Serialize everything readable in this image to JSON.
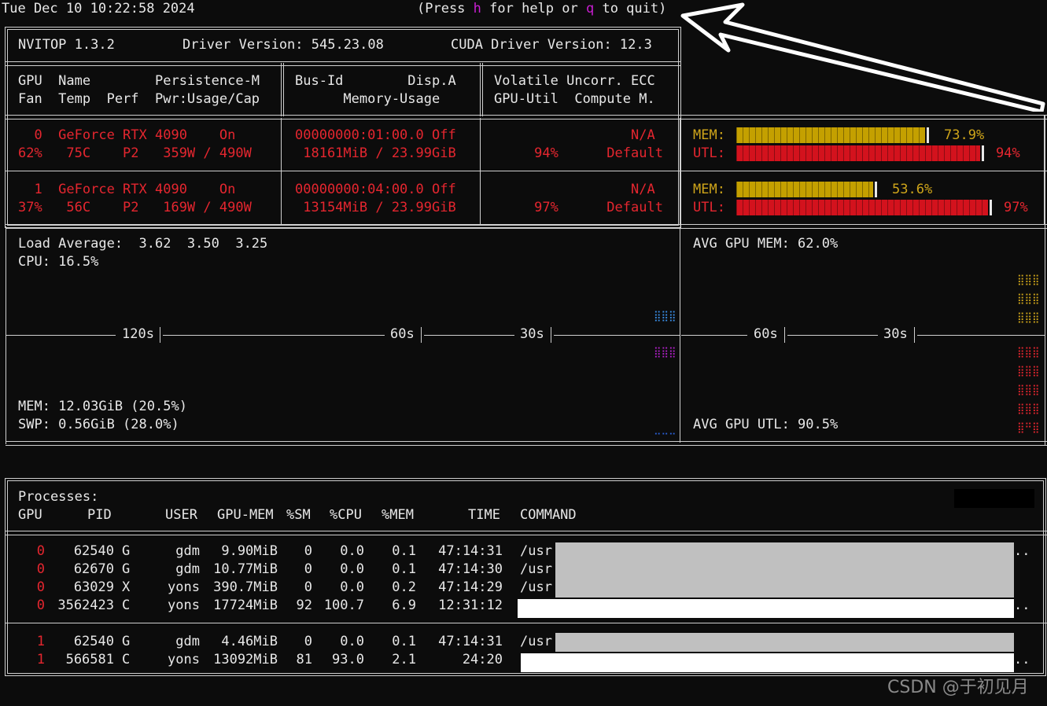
{
  "topbar": {
    "datetime": "Tue Dec 10 10:22:58 2024",
    "help_prefix": "(Press ",
    "help_key": "h",
    "help_mid": " for help or ",
    "quit_key": "q",
    "help_suffix": " to quit)"
  },
  "header": {
    "app": "NVITOP 1.3.2",
    "driver": "Driver Version: 545.23.08",
    "cuda": "CUDA Driver Version: 12.3"
  },
  "columns": {
    "c1_r1": "GPU  Name        Persistence-M",
    "c1_r2": "Fan  Temp  Perf  Pwr:Usage/Cap",
    "c2_r1": "Bus-Id        Disp.A",
    "c2_r2": "      Memory-Usage",
    "c3_r1": "Volatile Uncorr. ECC",
    "c3_r2": "GPU-Util  Compute M."
  },
  "gpus": [
    {
      "l1c1": "  0  GeForce RTX 4090    On",
      "l2c1": "62%   75C    P2   359W / 490W",
      "l1c2": "00000000:01:00.0 Off",
      "l2c2": " 18161MiB / 23.99GiB",
      "l1c3": "                 N/A",
      "l2c3": "     94%      Default",
      "mem_label": "MEM:",
      "mem_pct": "73.9%",
      "mem_frac": 0.739,
      "utl_label": "UTL:",
      "utl_pct": "94%",
      "utl_frac": 0.94
    },
    {
      "l1c1": "  1  GeForce RTX 4090    On",
      "l2c1": "37%   56C    P2   169W / 490W",
      "l1c2": "00000000:04:00.0 Off",
      "l2c2": " 13154MiB / 23.99GiB",
      "l1c3": "                 N/A",
      "l2c3": "     97%      Default",
      "mem_label": "MEM:",
      "mem_pct": "53.6%",
      "mem_frac": 0.536,
      "utl_label": "UTL:",
      "utl_pct": "97%",
      "utl_frac": 0.97
    }
  ],
  "host": {
    "load": "Load Average:  3.62  3.50  3.25",
    "cpu": "CPU: 16.5%",
    "mem": "MEM: 12.03GiB (20.5%)",
    "swp": "SWP: 0.56GiB (28.0%)",
    "t120": "120s",
    "t60": "60s",
    "t30": "30s"
  },
  "gpuavg": {
    "mem": "AVG GPU MEM: 62.0%",
    "utl": "AVG GPU UTL: 90.5%",
    "t60": "60s",
    "t30": "30s"
  },
  "processes": {
    "title": "Processes:",
    "head": [
      "GPU",
      "PID",
      "USER",
      "GPU-MEM",
      "%SM",
      "%CPU",
      "%MEM",
      "TIME",
      "COMMAND"
    ],
    "group1": [
      {
        "gpu": "0",
        "pid": "62540",
        "type": "G",
        "user": "gdm",
        "mem": "9.90MiB",
        "sm": "0",
        "cpu": "0.0",
        "pmem": "0.1",
        "time": "47:14:31",
        "cmd": "/usr"
      },
      {
        "gpu": "0",
        "pid": "62670",
        "type": "G",
        "user": "gdm",
        "mem": "10.77MiB",
        "sm": "0",
        "cpu": "0.0",
        "pmem": "0.1",
        "time": "47:14:30",
        "cmd": "/usr"
      },
      {
        "gpu": "0",
        "pid": "63029",
        "type": "X",
        "user": "yons",
        "mem": "390.7MiB",
        "sm": "0",
        "cpu": "0.0",
        "pmem": "0.2",
        "time": "47:14:29",
        "cmd": "/usr"
      },
      {
        "gpu": "0",
        "pid": "3562423",
        "type": "C",
        "user": "yons",
        "mem": "17724MiB",
        "sm": "92",
        "cpu": "100.7",
        "pmem": "6.9",
        "time": "12:31:12",
        "cmd": ""
      }
    ],
    "group2": [
      {
        "gpu": "1",
        "pid": "62540",
        "type": "G",
        "user": "gdm",
        "mem": "4.46MiB",
        "sm": "0",
        "cpu": "0.0",
        "pmem": "0.1",
        "time": "47:14:31",
        "cmd": "/usr"
      },
      {
        "gpu": "1",
        "pid": "566581",
        "type": "C",
        "user": "yons",
        "mem": "13092MiB",
        "sm": "81",
        "cpu": "93.0",
        "pmem": "2.1",
        "time": "24:20",
        "cmd": ""
      }
    ],
    "ellipsis": ".."
  },
  "watermark": "CSDN @于初见月"
}
